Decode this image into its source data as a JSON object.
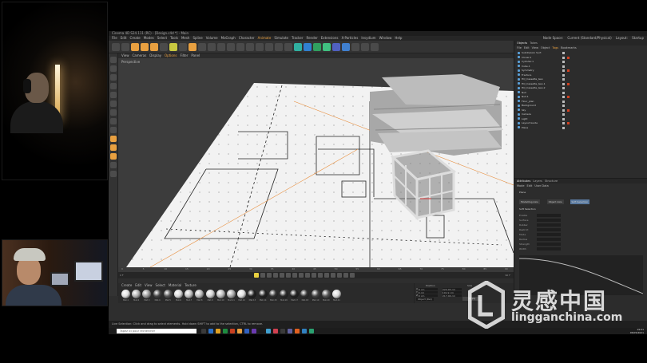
{
  "window": {
    "title": "Cinema 4D S24.111 (RC) - [Design.c4d *] - Main",
    "menu": [
      "File",
      "Edit",
      "Create",
      "Modes",
      "Select",
      "Tools",
      "Mesh",
      "Spline",
      "Volume",
      "MoGraph",
      "Character",
      "Animate",
      "Simulate",
      "Tracker",
      "Render",
      "Extensions",
      "X-Particles",
      "Insydium",
      "Window",
      "Help"
    ],
    "menu_highlight": "Animate",
    "node_space": "Node Space:",
    "node_space_value": "Current (Standard/Physical)",
    "layout_label": "Layout:",
    "layout_value": "Startup"
  },
  "viewport": {
    "menu": [
      "View",
      "Cameras",
      "Display",
      "Options",
      "Filter",
      "Panel"
    ],
    "menu_highlight": "Options",
    "label": "Perspective"
  },
  "timeline": {
    "ticks": [
      "0",
      "5",
      "10",
      "15",
      "20",
      "25",
      "30",
      "35",
      "40",
      "45",
      "50",
      "55",
      "60",
      "65",
      "70",
      "75",
      "80",
      "85",
      "90"
    ],
    "start": "0 F",
    "end": "90 F"
  },
  "materials": {
    "menu": [
      "Create",
      "Edit",
      "View",
      "Select",
      "Material",
      "Texture"
    ],
    "items": [
      "Mat.1",
      "Mat.2",
      "Mat.3",
      "Mat.4",
      "Mat.5",
      "Mat.6",
      "Mat.7",
      "Mat.8",
      "Mat.9",
      "Mat.10",
      "Mat.11",
      "Mat.12",
      "Mat.13",
      "Mat.14",
      "Mat.15",
      "Mat.16",
      "Mat.17",
      "Mat.18",
      "Mat.19",
      "Mat.20",
      "Mat.21"
    ]
  },
  "coordinates": {
    "position_label": "Position",
    "size_label": "Size",
    "rows": [
      {
        "axis": "X",
        "pos": "0 cm",
        "size": "220.45 cm"
      },
      {
        "axis": "Y",
        "pos": "0 cm",
        "size": "101.9 cm"
      },
      {
        "axis": "Z",
        "pos": "0 cm",
        "size": "217.46 cm"
      }
    ],
    "mode": "Object (Rel)",
    "apply": "Apply"
  },
  "objects": {
    "tabs": [
      "Objects",
      "Takes"
    ],
    "menu": [
      "File",
      "Edit",
      "View",
      "Object",
      "Tags",
      "Bookmarks"
    ],
    "menu_highlight": "Tags",
    "rows": [
      "Subdivision Surf.",
      "Cloner.1",
      "Cylinder.1",
      "Cube.1",
      "Symmetry",
      "Fracture",
      "HQ_Cassette_Geo",
      "HQ_Cassette_Geo.1",
      "HQ_Cassette_Geo.2",
      "Null",
      "Null.1",
      "Floor_plan",
      "Background",
      "Sky",
      "Camera",
      "Light",
      "Layout Guide",
      "Plane"
    ]
  },
  "attributes": {
    "tabs": [
      "Attributes",
      "Layers",
      "Structure"
    ],
    "menu": [
      "Mode",
      "Edit",
      "User Data"
    ],
    "object": "Plane",
    "buttons": [
      "Modelling Axis",
      "Object Axis",
      "Soft Selection"
    ],
    "section": "Soft Selection",
    "fields": [
      "Enable",
      "Surface",
      "Rubber",
      "Restrict",
      "Mode",
      "Radius",
      "Strength",
      "Width"
    ]
  },
  "status_text": "Live Selection: Click and drag to select elements. Hold down SHIFT to add to the selection, CTRL to remove.",
  "taskbar": {
    "search": "Tapez ici pour rechercher",
    "time": "19:01",
    "date": "05/05/2021"
  },
  "watermark": {
    "cn": "灵感中国",
    "en": "lingganchina.com"
  }
}
